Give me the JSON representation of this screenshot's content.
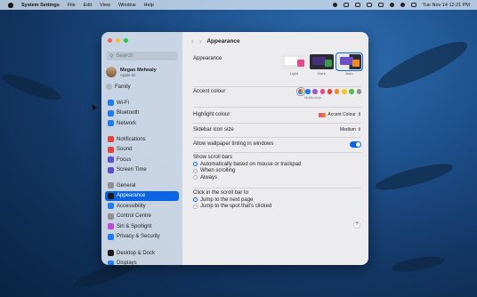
{
  "menubar": {
    "app_name": "System Settings",
    "menus": [
      "File",
      "Edit",
      "View",
      "Window",
      "Help"
    ],
    "clock": "Tue Nov 14  12:21 PM"
  },
  "window": {
    "search_placeholder": "Search",
    "profile": {
      "name": "Megan Mehealy",
      "subtitle": "Apple ID"
    },
    "family_label": "Family",
    "sidebar_items": [
      {
        "label": "Wi-Fi",
        "icon": "wifi-icon",
        "color": "#1e7cf2"
      },
      {
        "label": "Bluetooth",
        "icon": "bluetooth-icon",
        "color": "#1e7cf2"
      },
      {
        "label": "Network",
        "icon": "globe-icon",
        "color": "#1e7cf2"
      },
      {
        "label": "Notifications",
        "icon": "bell-icon",
        "color": "#e5403a"
      },
      {
        "label": "Sound",
        "icon": "speaker-icon",
        "color": "#e5403a"
      },
      {
        "label": "Focus",
        "icon": "moon-icon",
        "color": "#5b4ecb"
      },
      {
        "label": "Screen Time",
        "icon": "hourglass-icon",
        "color": "#5b4ecb"
      },
      {
        "label": "General",
        "icon": "gear-icon",
        "color": "#8e8e93"
      },
      {
        "label": "Appearance",
        "icon": "appearance-icon",
        "color": "#1b1b1b",
        "selected": true
      },
      {
        "label": "Accessibility",
        "icon": "accessibility-icon",
        "color": "#1e7cf2"
      },
      {
        "label": "Control Centre",
        "icon": "control-centre-icon",
        "color": "#8e8e93"
      },
      {
        "label": "Siri & Spotlight",
        "icon": "siri-icon",
        "color": "#c04ad6"
      },
      {
        "label": "Privacy & Security",
        "icon": "hand-icon",
        "color": "#1e7cf2"
      },
      {
        "label": "Desktop & Dock",
        "icon": "dock-icon",
        "color": "#1b1b1b"
      },
      {
        "label": "Displays",
        "icon": "display-icon",
        "color": "#1e7cf2"
      }
    ],
    "page_title": "Appearance",
    "appearance_label": "Appearance",
    "themes": [
      {
        "label": "Light",
        "selected": false
      },
      {
        "label": "Dark",
        "selected": false
      },
      {
        "label": "Auto",
        "selected": true
      }
    ],
    "accent_label": "Accent colour",
    "accent_caption": "Multicolour",
    "accent_colors": [
      "#b46de0",
      "#1e7cf2",
      "#9b59d0",
      "#e24a8c",
      "#e5403a",
      "#f08a24",
      "#f5c522",
      "#5cb84a",
      "#8e8e93"
    ],
    "highlight_label": "Highlight colour",
    "highlight_value": "Accent Colour",
    "sidebar_icon_label": "Sidebar icon size",
    "sidebar_icon_value": "Medium",
    "tinting_label": "Allow wallpaper tinting in windows",
    "scroll_label": "Show scroll bars",
    "scroll_options": [
      {
        "label": "Automatically based on mouse or trackpad",
        "selected": true
      },
      {
        "label": "When scrolling",
        "selected": false
      },
      {
        "label": "Always",
        "selected": false
      }
    ],
    "click_label": "Click in the scroll bar to",
    "click_options": [
      {
        "label": "Jump to the next page",
        "selected": true
      },
      {
        "label": "Jump to the spot that's clicked",
        "selected": false
      }
    ],
    "help": "?"
  }
}
